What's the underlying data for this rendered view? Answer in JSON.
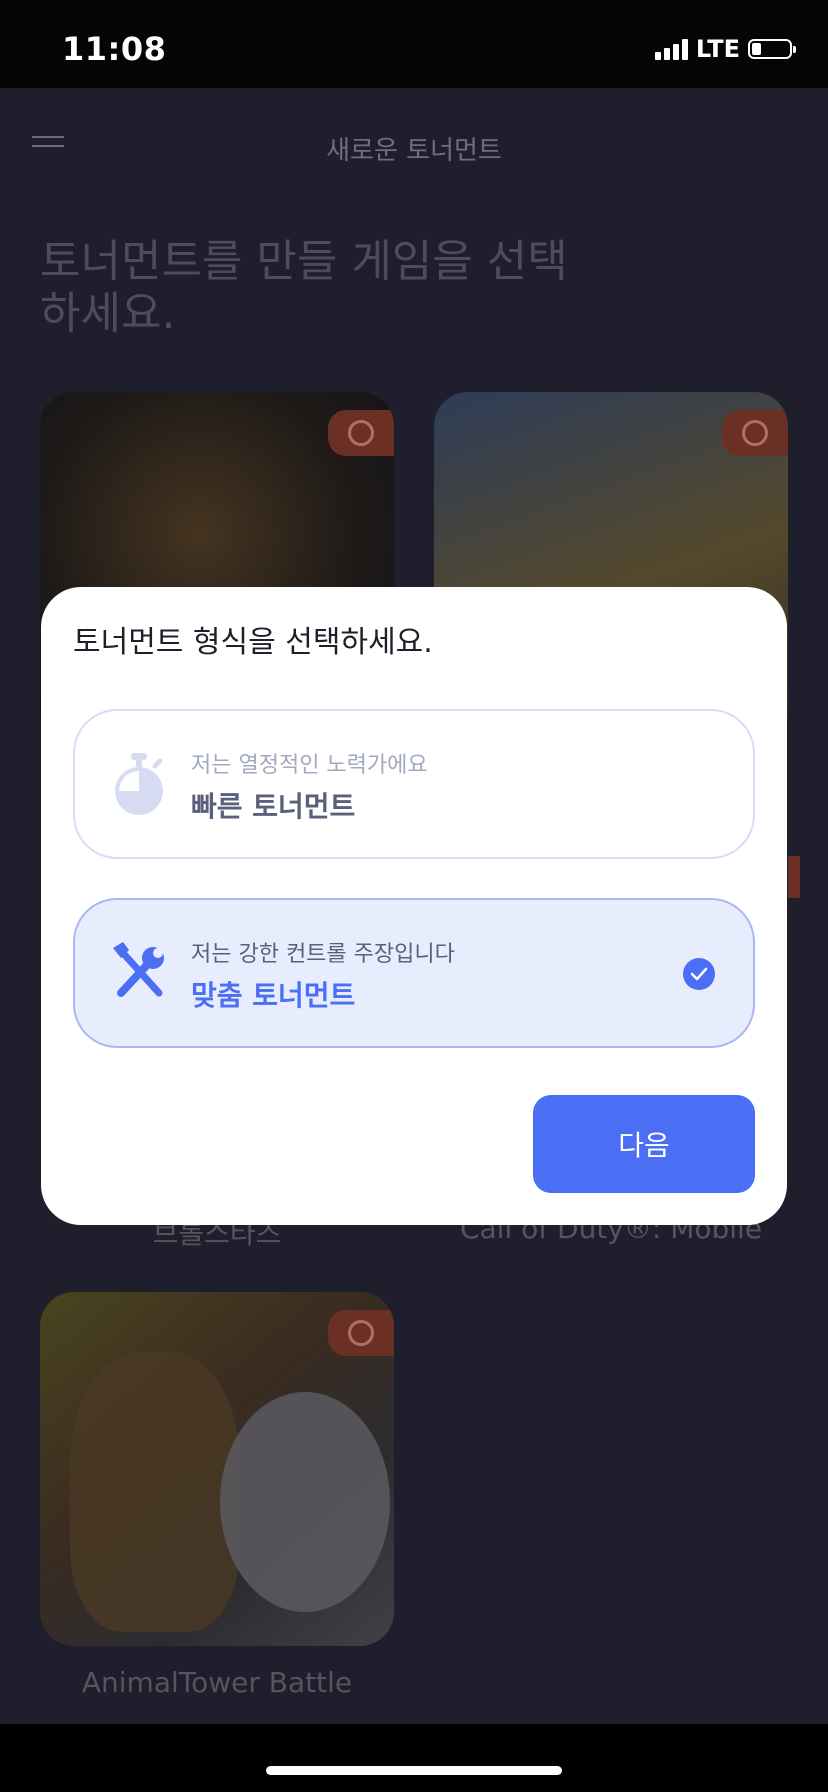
{
  "status_bar": {
    "time": "11:08",
    "network": "LTE",
    "battery_level": 0.25
  },
  "header": {
    "title": "새로운 토너먼트"
  },
  "page": {
    "heading": "토너먼트를 만들 게임을 선택하세요."
  },
  "games": [
    {
      "label": "브롤스타즈"
    },
    {
      "label": "Call of Duty®: Mobile"
    },
    {
      "label": "AnimalTower Battle"
    }
  ],
  "modal": {
    "title": "토너먼트 형식을 선택하세요.",
    "options": [
      {
        "subtitle": "저는 열정적인 노력가에요",
        "title": "빠른 토너먼트",
        "icon": "stopwatch-icon",
        "selected": false
      },
      {
        "subtitle": "저는 강한 컨트롤 주장입니다",
        "title": "맞춤 토너먼트",
        "icon": "tools-icon",
        "selected": true
      }
    ],
    "next_label": "다음"
  },
  "colors": {
    "accent": "#4a6ef4",
    "selected_bg": "#e8edfd",
    "overlay": "#1e1e2c"
  }
}
